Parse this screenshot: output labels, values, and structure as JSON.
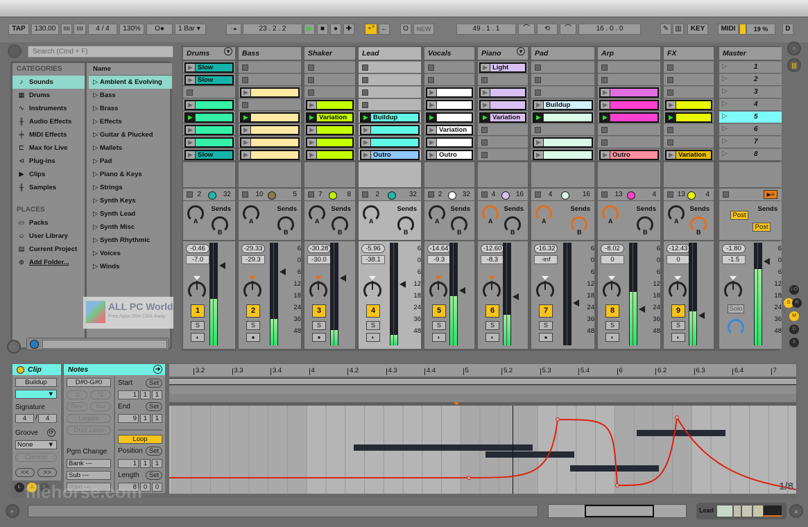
{
  "toolbar": {
    "tap": "TAP",
    "tempo": "130.00",
    "nudge_down": "IIII",
    "nudge_up": "IIII",
    "signature": "4 / 4",
    "zoom": "130%",
    "metronome": "O●",
    "quantize": "1 Bar",
    "follow": "··▸",
    "position": "23 .   2 .   2",
    "play": "▶",
    "stop": "■",
    "record": "●",
    "overdub": "✚",
    "automation": "∘°",
    "back_to_arrangement": "←",
    "loop_circle": "O",
    "new": "NEW",
    "loop_start": "49 .   1 .   1",
    "punch_in": "⌒",
    "loop_toggle": "⟲",
    "punch_out": "⌒",
    "loop_length": "16 .   0 .   0",
    "draw_mode": "✎",
    "keyboard": "▥",
    "key": "KEY",
    "midi": "MIDI",
    "cpu": "19 %",
    "d": "D"
  },
  "browser": {
    "search_placeholder": "Search (Cmd + F)",
    "categories_header": "CATEGORIES",
    "categories": [
      {
        "icon": "♪",
        "label": "Sounds",
        "selected": true
      },
      {
        "icon": "▦",
        "label": "Drums"
      },
      {
        "icon": "∿",
        "label": "Instruments"
      },
      {
        "icon": "╫",
        "label": "Audio Effects"
      },
      {
        "icon": "╪",
        "label": "MIDI Effects"
      },
      {
        "icon": "⊏",
        "label": "Max for Live"
      },
      {
        "icon": "⊲",
        "label": "Plug-ins"
      },
      {
        "icon": "▶",
        "label": "Clips"
      },
      {
        "icon": "╫",
        "label": "Samples"
      }
    ],
    "places_header": "PLACES",
    "places": [
      {
        "icon": "▭",
        "label": "Packs"
      },
      {
        "icon": "☺",
        "label": "User Library"
      },
      {
        "icon": "▤",
        "label": "Current Project"
      },
      {
        "icon": "⊕",
        "label": "Add Folder..."
      }
    ],
    "name_header": "Name",
    "names": [
      "Ambient & Evolving",
      "Bass",
      "Brass",
      "Effects",
      "Guitar & Plucked",
      "Mallets",
      "Pad",
      "Piano & Keys",
      "Strings",
      "Synth Keys",
      "Synth Lead",
      "Synth Misc",
      "Synth Rhythmic",
      "Voices",
      "Winds"
    ],
    "watermark_title": "ALL PC World",
    "watermark_sub": "Free Apps One Click Away"
  },
  "tracks": [
    {
      "name": "Drums",
      "color": "#1fb8a8",
      "io_left": "2",
      "io_right": "32",
      "io_color": "#1fb8a8",
      "volume": "-0.46",
      "peak": "-7.0",
      "number": "1",
      "meter": 0.45,
      "clips": [
        {
          "label": "Slow",
          "color": "#16b3a8"
        },
        {
          "label": "Slow",
          "color": "#16b3a8"
        },
        null,
        {
          "label": "",
          "color": "#34f0a8"
        },
        {
          "label": "",
          "color": "#34f0a8",
          "playing": true
        },
        {
          "label": "",
          "color": "#34f0a8"
        },
        {
          "label": "",
          "color": "#34f0a8"
        },
        {
          "label": "Slow",
          "color": "#16b3a8"
        }
      ]
    },
    {
      "name": "Bass",
      "color": "#ffe8a0",
      "io_left": "10",
      "io_right": "5",
      "io_color": "#8a7a50",
      "volume": "-29.33",
      "peak": "-29.3",
      "number": "2",
      "meter": 0.26,
      "clips": [
        null,
        null,
        {
          "label": "",
          "color": "#ffe9a3"
        },
        null,
        {
          "label": "",
          "color": "#ffe9a3",
          "playing": true
        },
        {
          "label": "",
          "color": "#ffe9a3"
        },
        {
          "label": "",
          "color": "#ffe9a3"
        },
        {
          "label": "",
          "color": "#ffe9a3"
        }
      ]
    },
    {
      "name": "Shaker",
      "color": "#c0ff00",
      "io_left": "7",
      "io_right": "8",
      "io_color": "#c0f000",
      "volume": "-30.28",
      "peak": "-30.0",
      "number": "3",
      "meter": 0.15,
      "clips": [
        null,
        null,
        null,
        {
          "label": "",
          "color": "#c4ff00"
        },
        {
          "label": "Variation",
          "color": "#c4ff00",
          "playing": true
        },
        {
          "label": "",
          "color": "#c4ff00"
        },
        {
          "label": "",
          "color": "#c4ff00"
        },
        {
          "label": "",
          "color": "#c4ff00"
        }
      ]
    },
    {
      "name": "Lead",
      "color": "#60f0e0",
      "io_left": "2",
      "io_right": "32",
      "io_color": "#1fb8a8",
      "volume": "-5.96",
      "peak": "-38.1",
      "number": "4",
      "meter": 0.1,
      "clips": [
        null,
        null,
        null,
        null,
        {
          "label": "Buildup",
          "color": "#60f8e6",
          "playing": true
        },
        {
          "label": "",
          "color": "#60f8e6"
        },
        {
          "label": "",
          "color": "#60f8e6"
        },
        {
          "label": "Outro",
          "color": "#90c8ff"
        }
      ]
    },
    {
      "name": "Vocals",
      "color": "#ffffff",
      "io_left": "2",
      "io_right": "32",
      "io_color": "#ffffff",
      "volume": "-14.64",
      "peak": "-9.3",
      "number": "5",
      "meter": 0.48,
      "clips": [
        null,
        null,
        {
          "label": "",
          "color": "#ffffff"
        },
        {
          "label": "",
          "color": "#ffffff"
        },
        {
          "label": "",
          "color": "#ffffff",
          "playing": true
        },
        {
          "label": "Variation",
          "color": "#ffffff"
        },
        {
          "label": "",
          "color": "#ffffff"
        },
        {
          "label": "Outro",
          "color": "#ffffff"
        }
      ]
    },
    {
      "name": "Piano",
      "color": "#d8c0f0",
      "io_left": "4",
      "io_right": "16",
      "io_color": "#d8c0f0",
      "volume": "-12.60",
      "peak": "-8.3",
      "number": "6",
      "meter": 0.3,
      "clips": [
        {
          "label": "Light",
          "color": "#d8c0f0"
        },
        null,
        {
          "label": "",
          "color": "#d8c0f0"
        },
        {
          "label": "",
          "color": "#d8c0f0"
        },
        {
          "label": "Variation",
          "color": "#d8c0f0",
          "playing": true
        },
        null,
        null,
        null
      ]
    },
    {
      "name": "Pad",
      "color": "#d8f8e8",
      "io_left": "4",
      "io_right": "16",
      "io_color": "#d8f8e8",
      "volume": "-16.32",
      "peak": "-inf",
      "number": "7",
      "meter": 0.0,
      "clips": [
        null,
        null,
        null,
        {
          "label": "Buildup",
          "color": "#d4f0f8"
        },
        {
          "label": "",
          "color": "#dafbe8",
          "playing": true
        },
        null,
        {
          "label": "",
          "color": "#dafbe8"
        },
        {
          "label": "",
          "color": "#dafbe8"
        }
      ]
    },
    {
      "name": "Arp",
      "color": "#ff40d0",
      "io_left": "13",
      "io_right": "4",
      "io_color": "#ff40d0",
      "volume": "-8.02",
      "peak": "0",
      "number": "8",
      "meter": 0.52,
      "clips": [
        null,
        null,
        {
          "label": "",
          "color": "#e070e0"
        },
        {
          "label": "",
          "color": "#ff40d0"
        },
        {
          "label": "",
          "color": "#ff40d0",
          "playing": true
        },
        null,
        null,
        {
          "label": "Outro",
          "color": "#ff90a0"
        }
      ]
    },
    {
      "name": "FX",
      "color": "#e8f800",
      "io_left": "13",
      "io_right": "4",
      "io_color": "#e8f800",
      "volume": "-12.43",
      "peak": "0",
      "number": "9",
      "meter": 0.33,
      "clips": [
        null,
        null,
        null,
        {
          "label": "",
          "color": "#e8f800"
        },
        {
          "label": "",
          "color": "#e8f800",
          "playing": true
        },
        null,
        null,
        {
          "label": "Variation",
          "color": "#e8c000"
        }
      ]
    }
  ],
  "master": {
    "name": "Master",
    "scenes": [
      "1",
      "2",
      "3",
      "4",
      "5",
      "6",
      "7",
      "8"
    ],
    "active_scene": "5",
    "volume": "-1.80",
    "peak": "-1.5",
    "post_a": "Post",
    "post_b": "Post",
    "solo": "Solo",
    "meter": 0.74
  },
  "mixer": {
    "sends_label": "Sends",
    "knob_a": "A",
    "knob_b": "B",
    "solo_label": "S",
    "scale": [
      "6",
      "0",
      "6",
      "12",
      "18",
      "24",
      "36",
      "48"
    ]
  },
  "side_buttons": [
    "I·O",
    "S",
    "R",
    "M",
    "D",
    "X"
  ],
  "clip_panel": {
    "title": "Clip",
    "name": "Buildup",
    "color": "#6ff0e2",
    "signature_label": "Signature",
    "sig_num": "4",
    "sig_den": "4",
    "groove_label": "Groove",
    "groove_value": "None",
    "commit": "Commit",
    "prev": "<<",
    "next": ">>"
  },
  "notes_panel": {
    "title": "Notes",
    "range": "D#0-G#0",
    "half": ":2",
    "double": "*2",
    "rev": "Rev",
    "inv": "Inv",
    "legato": "Legato",
    "dupl_loop": "Dupl.Loop",
    "pgm_change": "Pgm Change",
    "bank": "Bank ---",
    "sub": "Sub ---",
    "pgm": "Pgm ---",
    "start_label": "Start",
    "end_label": "End",
    "set": "Set",
    "start": [
      "1",
      "1",
      "1"
    ],
    "end": [
      "9",
      "1",
      "1"
    ],
    "loop": "Loop",
    "position_label": "Position",
    "position": [
      "1",
      "1",
      "1"
    ],
    "length_label": "Length",
    "length": [
      "8",
      "0",
      "0"
    ]
  },
  "editor": {
    "ruler": [
      "3.2",
      "3.3",
      "3.4",
      "4",
      "4.2",
      "4.3",
      "4.4",
      "5",
      "5.2",
      "5.3",
      "5.4",
      "6",
      "6.2",
      "6.3",
      "6.4",
      "7"
    ],
    "grid_label": "1/8"
  },
  "bottom": {
    "device_label": "Lead"
  },
  "watermark_bottom": "filehorse.com"
}
